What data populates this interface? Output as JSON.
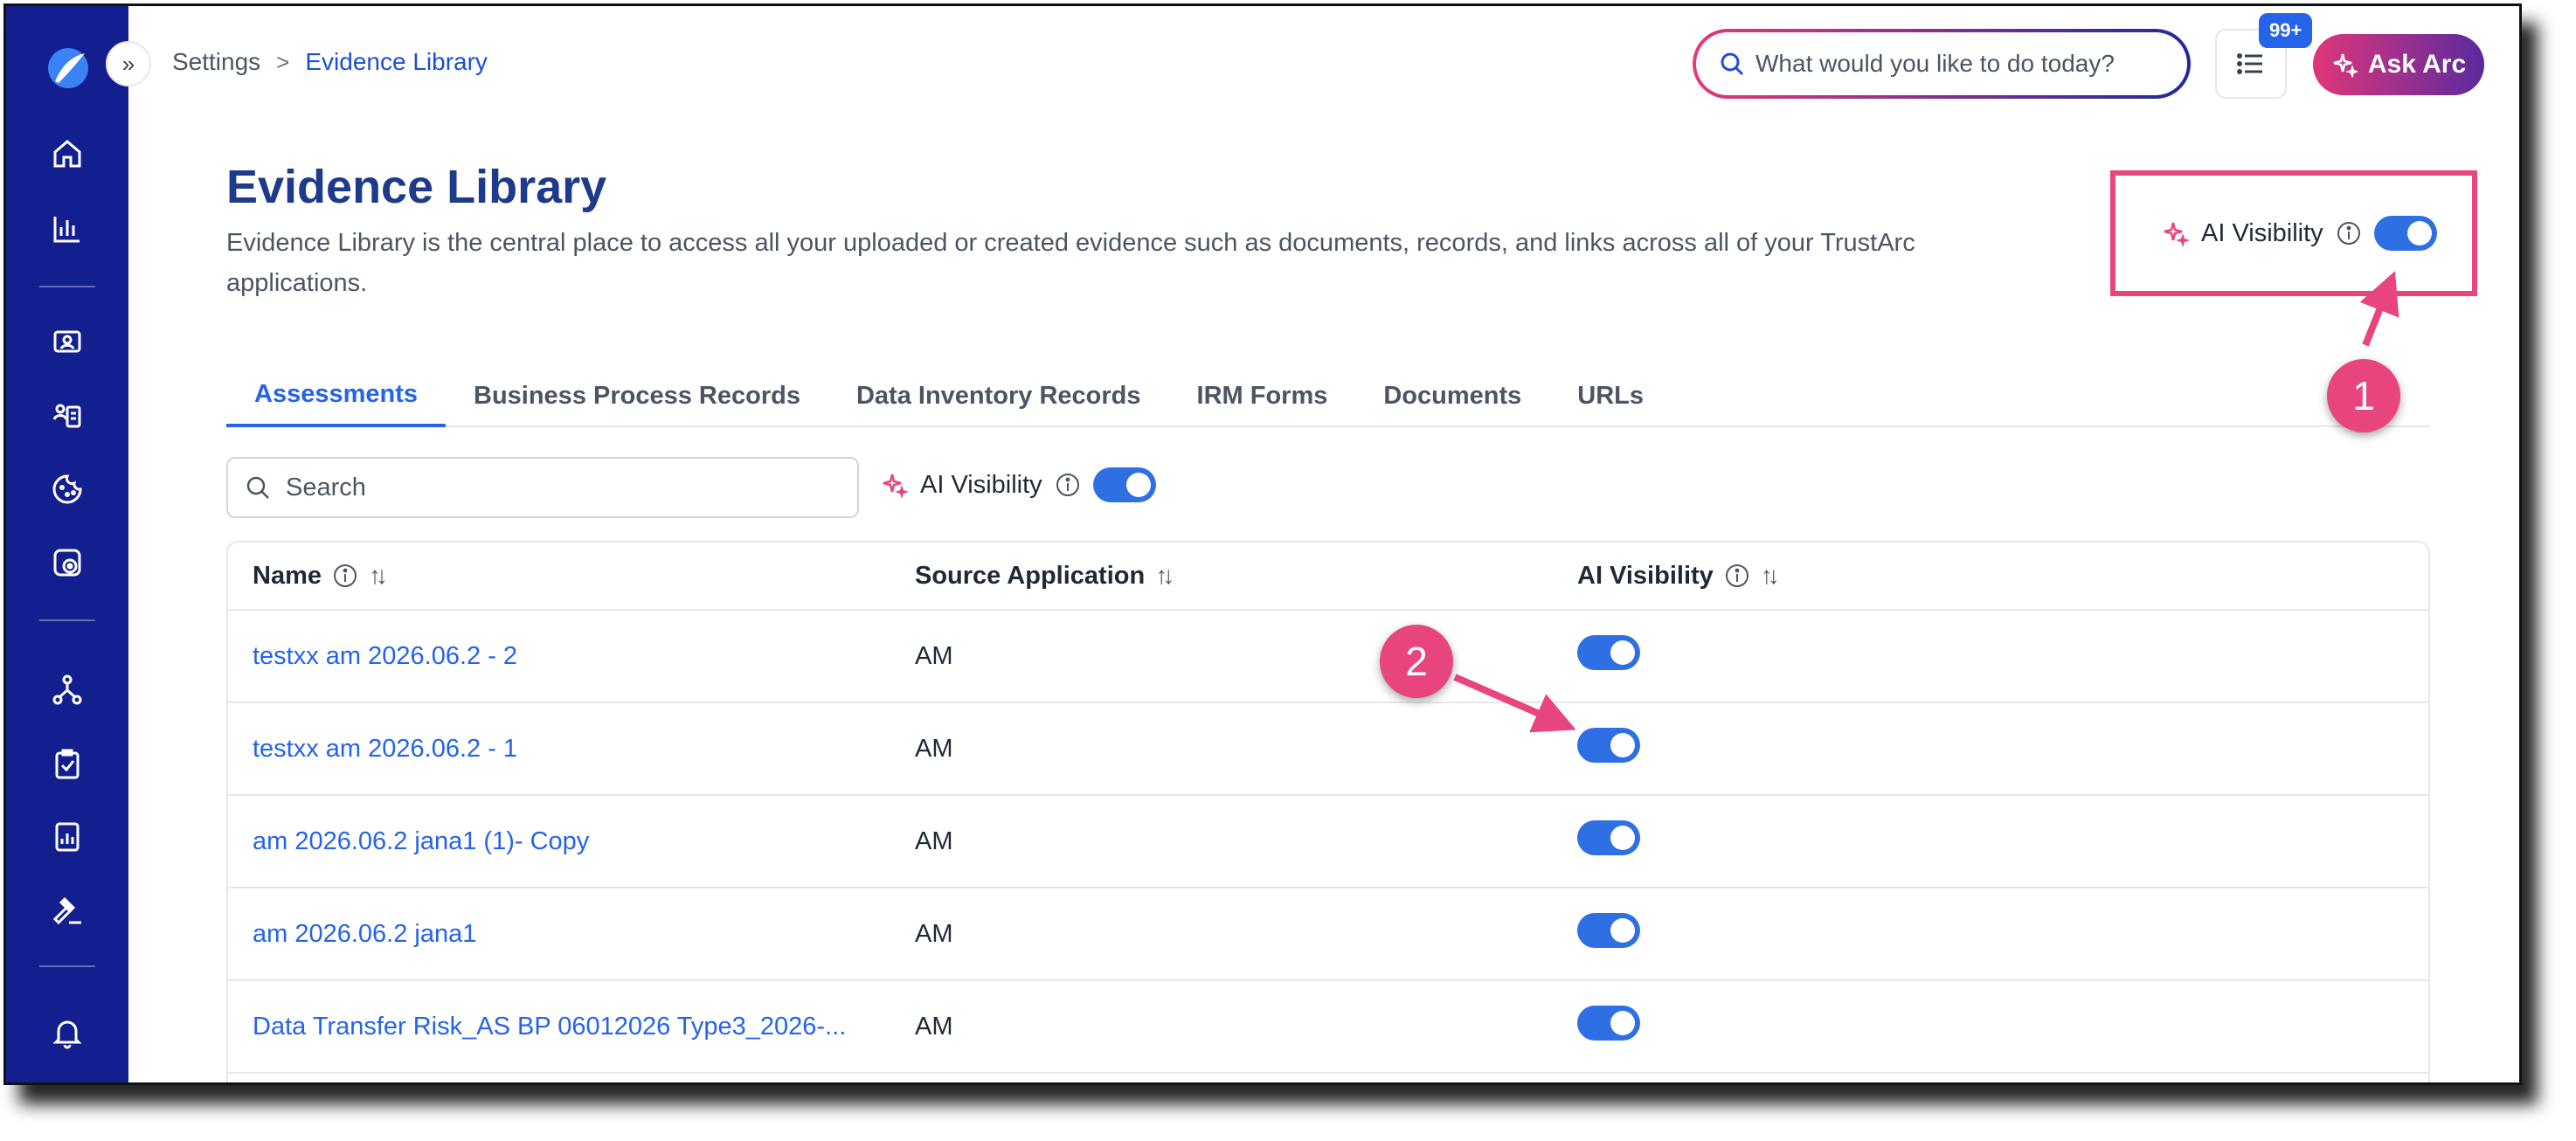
{
  "breadcrumb": {
    "parent": "Settings",
    "current": "Evidence Library",
    "separator": ">"
  },
  "header": {
    "search_placeholder": "What would you like to do today?",
    "badge": "99+",
    "ask_label": "Ask Arc",
    "sidebar_toggle": "»"
  },
  "page": {
    "title": "Evidence Library",
    "description": "Evidence Library is the central place to access all your uploaded or created evidence such as documents, records, and links across all of your TrustArc applications."
  },
  "ai_visibility": {
    "label": "AI Visibility",
    "enabled": true
  },
  "tabs": [
    {
      "label": "Assessments",
      "active": true
    },
    {
      "label": "Business Process Records"
    },
    {
      "label": "Data Inventory Records"
    },
    {
      "label": "IRM Forms"
    },
    {
      "label": "Documents"
    },
    {
      "label": "URLs"
    }
  ],
  "filter": {
    "search_placeholder": "Search",
    "ai_label": "AI Visibility"
  },
  "table": {
    "columns": [
      "Name",
      "Source Application",
      "AI Visibility"
    ],
    "rows": [
      {
        "name": "testxx am 2026.06.2 - 2",
        "source": "AM",
        "ai": true
      },
      {
        "name": "testxx am 2026.06.2 - 1",
        "source": "AM",
        "ai": true
      },
      {
        "name": "am 2026.06.2 jana1 (1)- Copy",
        "source": "AM",
        "ai": true
      },
      {
        "name": "am 2026.06.2 jana1",
        "source": "AM",
        "ai": true
      },
      {
        "name": "Data Transfer Risk_AS BP 06012026 Type3_2026-...",
        "source": "AM",
        "ai": true
      }
    ]
  },
  "annotations": {
    "callout_1": "1",
    "callout_2": "2"
  },
  "colors": {
    "sidebar": "#131f8f",
    "accent": "#2563eb",
    "highlight": "#e8457f",
    "toggle_on": "#2f6fe4"
  }
}
